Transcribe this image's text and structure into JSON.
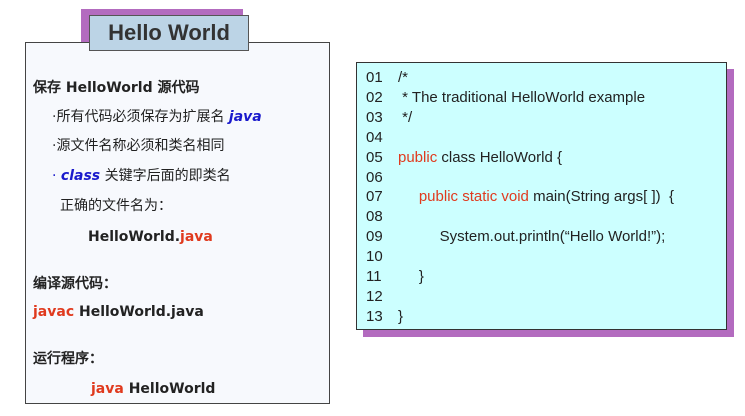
{
  "title": "Hello World",
  "left": {
    "heading": "保存 HelloWorld 源代码",
    "bullet_char": "·",
    "bullet1_text": "所有代码必须保存为扩展名",
    "bullet1_ext": "java",
    "bullet2_text": "源文件名称必须和类名相同",
    "bullet3_keyword": "class",
    "bullet3_text": "关键字后面的即类名",
    "correct_label": "正确的文件名为：",
    "filename_base": "HelloWorld.",
    "filename_ext": "java",
    "compile_label": "编译源代码：",
    "compile_cmd": "javac",
    "compile_arg": "HelloWorld.java",
    "run_label": "运行程序：",
    "run_cmd": "java",
    "run_arg": "HelloWorld"
  },
  "code": {
    "lines": [
      {
        "num": "01",
        "text": "/*"
      },
      {
        "num": "02",
        "text": " * The traditional HelloWorld example"
      },
      {
        "num": "03",
        "text": " */"
      },
      {
        "num": "04",
        "text": ""
      },
      {
        "num": "05",
        "kw": "public",
        "text": " class HelloWorld {"
      },
      {
        "num": "06",
        "text": ""
      },
      {
        "num": "07",
        "indent": "     ",
        "kw": "public static void",
        "text": " main(String args[ ])  {"
      },
      {
        "num": "08",
        "text": ""
      },
      {
        "num": "09",
        "text": "          System.out.println(“Hello World!”);"
      },
      {
        "num": "10",
        "text": ""
      },
      {
        "num": "11",
        "text": "     }"
      },
      {
        "num": "12",
        "text": ""
      },
      {
        "num": "13",
        "text": "}"
      }
    ]
  },
  "colors": {
    "accent_red": "#e03a1e",
    "accent_blue": "#1a1acc",
    "title_bg": "#bcd4e6",
    "shadow": "#b36bbf",
    "code_bg": "#ccffff"
  }
}
